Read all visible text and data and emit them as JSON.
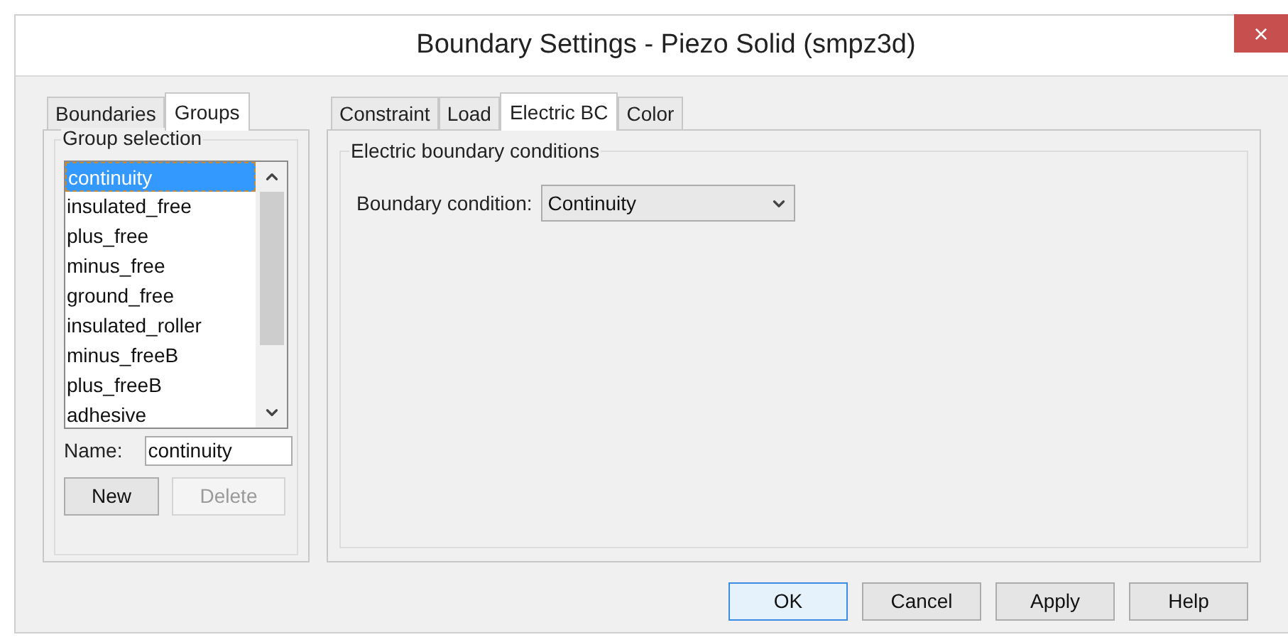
{
  "window": {
    "title": "Boundary Settings - Piezo Solid (smpz3d)",
    "close": "×"
  },
  "left_tabs": [
    {
      "label": "Boundaries",
      "selected": false
    },
    {
      "label": "Groups",
      "selected": true
    }
  ],
  "group_selection": {
    "title": "Group selection",
    "items": [
      {
        "label": "continuity",
        "selected": true
      },
      {
        "label": "insulated_free",
        "selected": false
      },
      {
        "label": "plus_free",
        "selected": false
      },
      {
        "label": "minus_free",
        "selected": false
      },
      {
        "label": "ground_free",
        "selected": false
      },
      {
        "label": "insulated_roller",
        "selected": false
      },
      {
        "label": "minus_freeB",
        "selected": false
      },
      {
        "label": "plus_freeB",
        "selected": false
      },
      {
        "label": "adhesive",
        "selected": false
      }
    ],
    "name_label": "Name:",
    "name_value": "continuity",
    "buttons": [
      {
        "label": "New",
        "disabled": false
      },
      {
        "label": "Delete",
        "disabled": true
      }
    ]
  },
  "right_tabs": [
    {
      "label": "Constraint",
      "selected": false
    },
    {
      "label": "Load",
      "selected": false
    },
    {
      "label": "Electric BC",
      "selected": true
    },
    {
      "label": "Color",
      "selected": false
    }
  ],
  "electric": {
    "title": "Electric boundary conditions",
    "field_label": "Boundary condition:",
    "value": "Continuity"
  },
  "buttons": [
    {
      "label": "OK",
      "default": true
    },
    {
      "label": "Cancel",
      "default": false
    },
    {
      "label": "Apply",
      "default": false
    },
    {
      "label": "Help",
      "default": false
    }
  ]
}
